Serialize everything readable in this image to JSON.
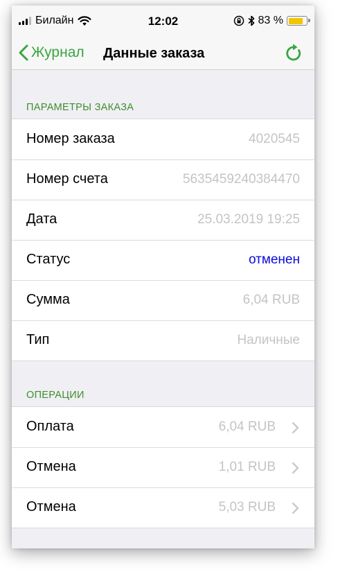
{
  "status_bar": {
    "carrier": "Билайн",
    "time": "12:02",
    "battery_percent": "83 %",
    "battery_level": 0.83,
    "signal_bars": 3,
    "icons": [
      "signal-icon",
      "wifi-icon",
      "orientation-lock-icon",
      "bluetooth-icon",
      "battery-icon"
    ]
  },
  "nav": {
    "back_label": "Журнал",
    "title": "Данные заказа",
    "refresh_icon": "refresh-icon"
  },
  "colors": {
    "accent": "#39a541",
    "status_blue": "#0a0ad8",
    "muted_value": "#c4c4c8",
    "section_header": "#3f8e2b"
  },
  "order_params": {
    "header": "ПАРАМЕТРЫ ЗАКАЗА",
    "rows": [
      {
        "label": "Номер заказа",
        "value": "4020545"
      },
      {
        "label": "Номер счета",
        "value": "5635459240384470"
      },
      {
        "label": "Дата",
        "value": "25.03.2019 19:25"
      },
      {
        "label": "Статус",
        "value": "отменен"
      },
      {
        "label": "Сумма",
        "value": "6,04 RUB"
      },
      {
        "label": "Тип",
        "value": "Наличные"
      }
    ]
  },
  "operations": {
    "header": "ОПЕРАЦИИ",
    "rows": [
      {
        "label": "Оплата",
        "value": "6,04 RUB"
      },
      {
        "label": "Отмена",
        "value": "1,01 RUB"
      },
      {
        "label": "Отмена",
        "value": "5,03 RUB"
      }
    ]
  }
}
